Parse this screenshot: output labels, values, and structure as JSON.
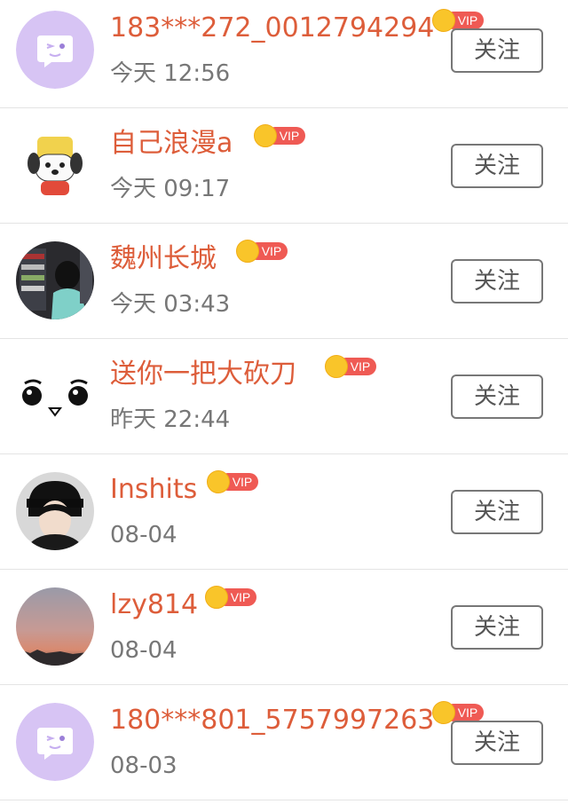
{
  "colors": {
    "name_color": "#dd5d3a",
    "time_color": "#777777",
    "vip_badge": "#ef5a54",
    "crown": "#f9c52a",
    "divider": "#e4e4e4"
  },
  "users": [
    {
      "name": "183***272_0012794294",
      "time": "今天 12:56",
      "vip": "VIP",
      "follow_label": "关注",
      "avatar_icon": "chat-bubble-wink-icon"
    },
    {
      "name": "自己浪漫a",
      "time": "今天 09:17",
      "vip": "VIP",
      "follow_label": "关注",
      "avatar_icon": "cartoon-dog-avatar"
    },
    {
      "name": "魏州长城",
      "time": "今天 03:43",
      "vip": "VIP",
      "follow_label": "关注",
      "avatar_icon": "photo-avatar"
    },
    {
      "name": "送你一把大砍刀",
      "time": "昨天 22:44",
      "vip": "VIP",
      "follow_label": "关注",
      "avatar_icon": "cartoon-face-avatar"
    },
    {
      "name": "Inshits",
      "time": "08-04",
      "vip": "VIP",
      "follow_label": "关注",
      "avatar_icon": "photo-avatar"
    },
    {
      "name": "lzy814",
      "time": "08-04",
      "vip": "VIP",
      "follow_label": "关注",
      "avatar_icon": "sunset-photo-avatar"
    },
    {
      "name": "180***801_5757997263",
      "time": "08-03",
      "vip": "VIP",
      "follow_label": "关注",
      "avatar_icon": "chat-bubble-wink-icon"
    }
  ]
}
